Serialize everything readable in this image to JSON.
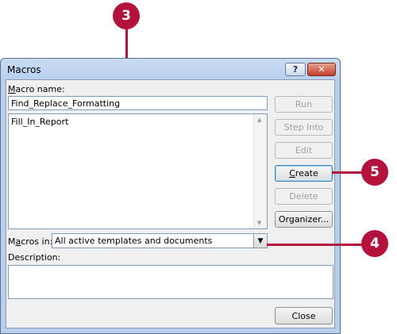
{
  "window": {
    "title": "Macros",
    "help_glyph": "?",
    "close_glyph": "✕"
  },
  "macro_name": {
    "label_accel": "M",
    "label_rest": "acro name:",
    "value": "Find_Replace_Formatting"
  },
  "macro_list": {
    "items": [
      "Fill_In_Report"
    ]
  },
  "buttons": {
    "run": "Run",
    "step_into": "Step Into",
    "edit": "Edit",
    "create_accel": "C",
    "create_rest": "reate",
    "delete": "Delete",
    "organizer": "Organizer...",
    "close": "Close"
  },
  "macros_in": {
    "label_prefix": "M",
    "label_accel": "a",
    "label_rest": "cros in:",
    "value": "All active templates and documents"
  },
  "description": {
    "label": "Description:"
  },
  "callouts": {
    "step3": "3",
    "step4": "4",
    "step5": "5",
    "color": "#b3123c"
  }
}
